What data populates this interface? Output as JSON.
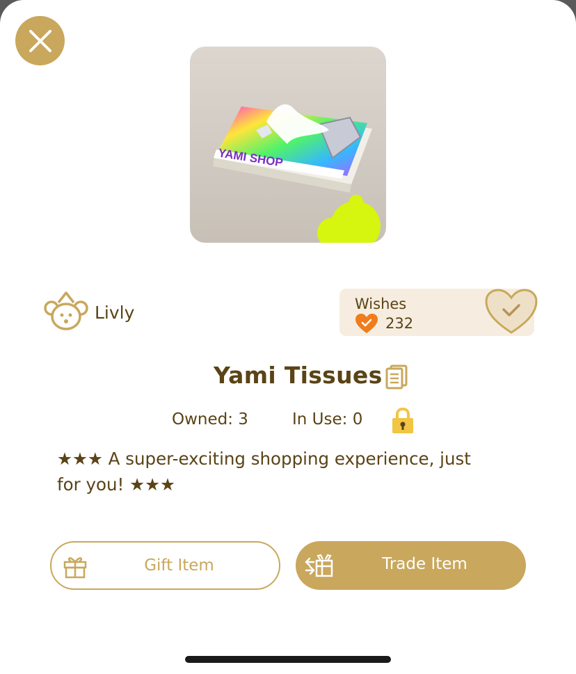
{
  "item": {
    "name": "Yami Tissues",
    "box_brand_text": "YAMI SHOP",
    "description": "★★★ A super-exciting shopping experience, just for you! ★★★"
  },
  "owner": {
    "name": "Livly",
    "icon": "bear-icon"
  },
  "wishes": {
    "label": "Wishes",
    "count": "232",
    "status": "checked"
  },
  "stats": {
    "owned": "Owned: 3",
    "in_use": "In Use: 0"
  },
  "actions": {
    "gift_label": "Gift Item",
    "trade_label": "Trade Item"
  },
  "icons": {
    "close": "close-icon",
    "copy": "document-copy-icon",
    "lock": "lock-icon",
    "gift": "gift-icon",
    "trade": "trade-icon",
    "wish": "heart-check-icon"
  },
  "colors": {
    "gold": "#c9a75c",
    "text": "#5a4316",
    "wishes_bg": "#f6ede0",
    "lock_yellow": "#f2c544",
    "heart_orange": "#f07c1c",
    "accent_lime": "#d6f50f"
  }
}
